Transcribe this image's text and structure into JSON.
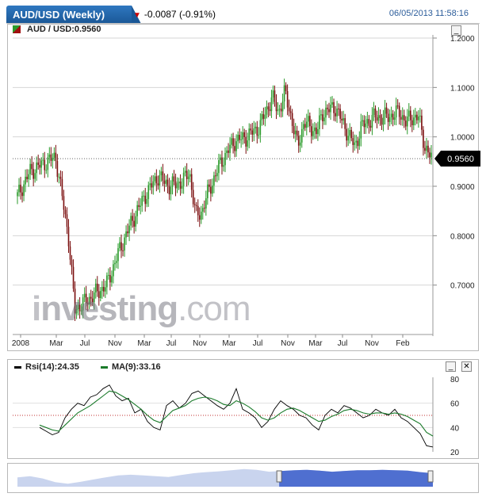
{
  "header": {
    "title": "AUD/USD (Weekly)",
    "change": "-0.0087 (-0.91%)",
    "datetime": "06/05/2013 11:58:16"
  },
  "main_chart": {
    "symbol_label": "AUD / USD:0.9560",
    "minimize_label": "_",
    "watermark": {
      "part1": "nvesting",
      "part2": ".com"
    }
  },
  "rsi_panel": {
    "legend": [
      {
        "label": "Rsi(14):24.35",
        "color": "#000000"
      },
      {
        "label": "MA(9):33.16",
        "color": "#1a7a2a"
      }
    ],
    "minimize_label": "_",
    "close_label": "✕"
  },
  "colors": {
    "up": "#2a9a2a",
    "down": "#7a0e0e",
    "rsi_ma": "#1a7a2a",
    "navigator": "#4f6fd0"
  },
  "chart_data": {
    "type": "candlestick",
    "title": "AUD / USD:0.9560",
    "x_range": [
      "2008-01",
      "2013-06"
    ],
    "x_ticks": [
      "2008",
      "Mar",
      "Jul",
      "Nov",
      "Mar",
      "Jul",
      "Nov",
      "Mar",
      "Jul",
      "Nov",
      "Mar",
      "Jul",
      "Nov",
      "Feb"
    ],
    "ylim": [
      0.6,
      1.2
    ],
    "y_ticks": [
      1.2,
      1.1,
      1.0,
      0.9,
      0.8,
      0.7
    ],
    "y_tick_labels": [
      "1.2000",
      "1.1000",
      "1.0000",
      "0.9000",
      "0.8000",
      "0.7000"
    ],
    "current_price": 0.956,
    "current_price_label": "0.9560",
    "price_points": [
      {
        "x": "2008-01",
        "y": 0.88
      },
      {
        "x": "2008-03",
        "y": 0.93
      },
      {
        "x": "2008-07",
        "y": 0.96
      },
      {
        "x": "2008-09",
        "y": 0.8
      },
      {
        "x": "2008-10",
        "y": 0.65
      },
      {
        "x": "2008-11",
        "y": 0.66
      },
      {
        "x": "2009-01",
        "y": 0.68
      },
      {
        "x": "2009-03",
        "y": 0.7
      },
      {
        "x": "2009-05",
        "y": 0.77
      },
      {
        "x": "2009-07",
        "y": 0.83
      },
      {
        "x": "2009-09",
        "y": 0.88
      },
      {
        "x": "2009-11",
        "y": 0.92
      },
      {
        "x": "2010-01",
        "y": 0.9
      },
      {
        "x": "2010-03",
        "y": 0.91
      },
      {
        "x": "2010-04",
        "y": 0.93
      },
      {
        "x": "2010-05",
        "y": 0.84
      },
      {
        "x": "2010-06",
        "y": 0.85
      },
      {
        "x": "2010-07",
        "y": 0.89
      },
      {
        "x": "2010-09",
        "y": 0.95
      },
      {
        "x": "2010-11",
        "y": 0.99
      },
      {
        "x": "2011-01",
        "y": 1.0
      },
      {
        "x": "2011-03",
        "y": 1.02
      },
      {
        "x": "2011-05",
        "y": 1.08
      },
      {
        "x": "2011-06",
        "y": 1.05
      },
      {
        "x": "2011-07",
        "y": 1.09
      },
      {
        "x": "2011-08",
        "y": 1.04
      },
      {
        "x": "2011-09",
        "y": 0.98
      },
      {
        "x": "2011-10",
        "y": 1.03
      },
      {
        "x": "2011-12",
        "y": 1.01
      },
      {
        "x": "2012-01",
        "y": 1.05
      },
      {
        "x": "2012-03",
        "y": 1.06
      },
      {
        "x": "2012-04",
        "y": 1.03
      },
      {
        "x": "2012-06",
        "y": 0.98
      },
      {
        "x": "2012-07",
        "y": 1.02
      },
      {
        "x": "2012-09",
        "y": 1.04
      },
      {
        "x": "2012-11",
        "y": 1.04
      },
      {
        "x": "2013-01",
        "y": 1.05
      },
      {
        "x": "2013-02",
        "y": 1.03
      },
      {
        "x": "2013-03",
        "y": 1.04
      },
      {
        "x": "2013-04",
        "y": 1.04
      },
      {
        "x": "2013-05",
        "y": 0.98
      },
      {
        "x": "2013-06",
        "y": 0.956
      }
    ],
    "rsi": {
      "ylim": [
        20,
        80
      ],
      "y_ticks": [
        80,
        60,
        40,
        20
      ],
      "y_tick_labels": [
        "80",
        "60",
        "40",
        "20"
      ],
      "reference_line": 50,
      "series": [
        {
          "name": "Rsi(14)",
          "values": [
            40,
            37,
            34,
            36,
            48,
            55,
            60,
            58,
            65,
            67,
            72,
            75,
            66,
            62,
            64,
            52,
            55,
            45,
            40,
            38,
            58,
            62,
            56,
            60,
            68,
            70,
            66,
            62,
            58,
            55,
            60,
            72,
            55,
            52,
            48,
            40,
            45,
            55,
            62,
            58,
            55,
            50,
            48,
            42,
            38,
            50,
            55,
            52,
            58,
            56,
            52,
            48,
            50,
            55,
            52,
            50,
            55,
            48,
            45,
            40,
            35,
            25,
            24
          ]
        },
        {
          "name": "MA(9)",
          "values": [
            42,
            40,
            38,
            37,
            42,
            47,
            52,
            55,
            58,
            62,
            66,
            70,
            69,
            66,
            63,
            59,
            55,
            50,
            46,
            44,
            49,
            54,
            56,
            58,
            62,
            64,
            65,
            64,
            62,
            59,
            58,
            62,
            60,
            57,
            53,
            48,
            46,
            48,
            52,
            55,
            56,
            54,
            51,
            48,
            45,
            46,
            49,
            51,
            54,
            55,
            54,
            52,
            51,
            52,
            52,
            51,
            52,
            51,
            49,
            46,
            43,
            36,
            33
          ]
        }
      ]
    },
    "navigator": {
      "values": [
        0.85,
        0.88,
        0.82,
        0.72,
        0.68,
        0.73,
        0.79,
        0.85,
        0.9,
        0.92,
        0.9,
        0.88,
        0.86,
        0.91,
        0.96,
        0.99,
        1.01,
        1.04,
        1.07,
        1.05,
        1.0,
        1.02,
        1.04,
        1.05,
        1.03,
        1.0,
        1.02,
        1.04,
        1.04,
        1.05,
        1.04,
        1.03,
        0.99,
        0.96
      ],
      "selection_start_fraction": 0.63,
      "selection_end_fraction": 1.0
    }
  }
}
